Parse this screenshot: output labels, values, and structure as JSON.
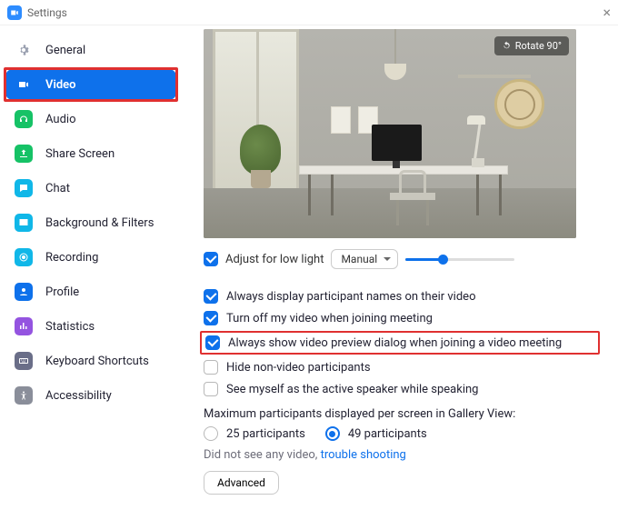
{
  "window": {
    "title": "Settings"
  },
  "sidebar": {
    "items": [
      {
        "label": "General",
        "icon_bg": "#ffffff",
        "icon": "gear",
        "active": false
      },
      {
        "label": "Video",
        "icon_bg": "#ffffff",
        "icon": "video",
        "active": true,
        "highlighted": true
      },
      {
        "label": "Audio",
        "icon_bg": "#16c266",
        "icon": "audio",
        "active": false
      },
      {
        "label": "Share Screen",
        "icon_bg": "#16c266",
        "icon": "share",
        "active": false
      },
      {
        "label": "Chat",
        "icon_bg": "#10b7e8",
        "icon": "chat",
        "active": false
      },
      {
        "label": "Background & Filters",
        "icon_bg": "#10b7e8",
        "icon": "bg",
        "active": false
      },
      {
        "label": "Recording",
        "icon_bg": "#10b7e8",
        "icon": "rec",
        "active": false
      },
      {
        "label": "Profile",
        "icon_bg": "#0E71EB",
        "icon": "profile",
        "active": false
      },
      {
        "label": "Statistics",
        "icon_bg": "#9454e0",
        "icon": "stats",
        "active": false
      },
      {
        "label": "Keyboard Shortcuts",
        "icon_bg": "#6a6e88",
        "icon": "kbd",
        "active": false
      },
      {
        "label": "Accessibility",
        "icon_bg": "#8a8e9a",
        "icon": "access",
        "active": false
      }
    ]
  },
  "video": {
    "rotate_label": "Rotate 90°",
    "adjust_low_light": {
      "label": "Adjust for low light",
      "checked": true,
      "mode": "Manual"
    },
    "options": [
      {
        "label": "Always display participant names on their video",
        "checked": true
      },
      {
        "label": "Turn off my video when joining meeting",
        "checked": true
      },
      {
        "label": "Always show video preview dialog when joining a video meeting",
        "checked": true,
        "highlighted": true
      },
      {
        "label": "Hide non-video participants",
        "checked": false
      },
      {
        "label": "See myself as the active speaker while speaking",
        "checked": false
      }
    ],
    "gallery_label": "Maximum participants displayed per screen in Gallery View:",
    "gallery_options": [
      {
        "label": "25 participants",
        "selected": false
      },
      {
        "label": "49 participants",
        "selected": true
      }
    ],
    "no_video_text": "Did not see any video,",
    "trouble_link": "trouble shooting",
    "advanced_label": "Advanced"
  }
}
